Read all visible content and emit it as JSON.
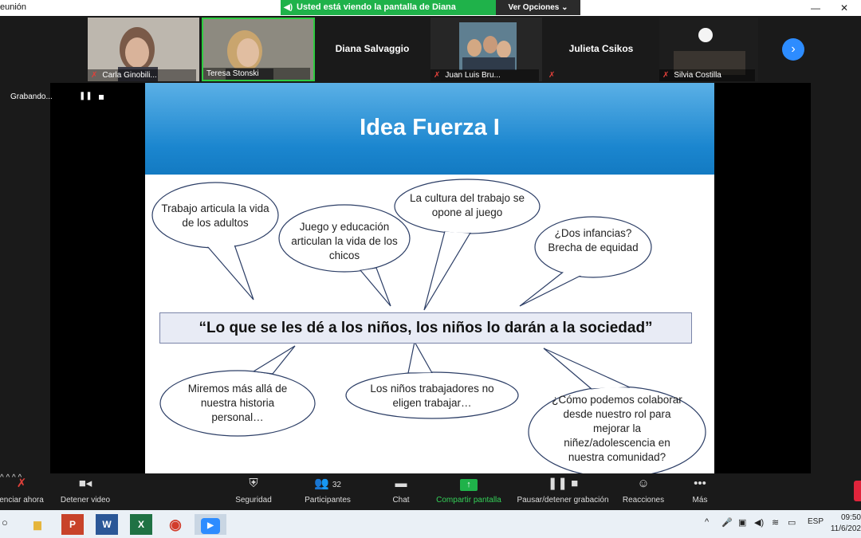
{
  "window": {
    "title": "eunión",
    "minimize": "—",
    "close": "✕"
  },
  "share_banner": {
    "text": "Usted está viendo la pantalla de Diana Salvaggio",
    "view_options": "Ver Opciones ⌄"
  },
  "participants": [
    {
      "name": "Carla Ginobili...",
      "muted": true,
      "photo": true
    },
    {
      "name": "Teresa Stonski",
      "muted": false,
      "photo": true
    },
    {
      "name": "Diana Salvaggio",
      "muted": false,
      "photo": false
    },
    {
      "name": "Juan Luis Bru...",
      "muted": true,
      "photo": true
    },
    {
      "name": "Julieta Csikos",
      "muted": true,
      "photo": false
    },
    {
      "name": "Silvia Costilla",
      "muted": true,
      "photo": true
    }
  ],
  "recording": {
    "label": "Grabando..."
  },
  "slide": {
    "title": "Idea Fuerza I",
    "bubbles": [
      "Trabajo articula la vida de los adultos",
      "Juego y educación articulan la vida de los chicos",
      "La cultura del trabajo se opone al juego",
      "¿Dos infancias? Brecha de equidad",
      "Miremos más allá de nuestra historia personal…",
      "Los niños trabajadores no eligen trabajar…",
      "¿Cómo podemos colaborar desde nuestro rol para mejorar la niñez/adolescencia en nuestra comunidad?"
    ],
    "quote": "“Lo que se les dé a los niños, los niños lo darán a la sociedad”"
  },
  "toolbar": {
    "mute": "enciar ahora",
    "video": "Detener video",
    "security": "Seguridad",
    "participants": "Participantes",
    "participants_count": "32",
    "chat": "Chat",
    "share": "Compartir pantalla",
    "record": "Pausar/detener grabación",
    "reactions": "Reacciones",
    "more": "Más"
  },
  "taskbar": {
    "lang": "ESP",
    "time": "09:50",
    "date": "11/6/202"
  },
  "colors": {
    "zoom_blue": "#2d8cff",
    "share_green": "#1fb24a",
    "slide_blue": "#1b86cf"
  }
}
